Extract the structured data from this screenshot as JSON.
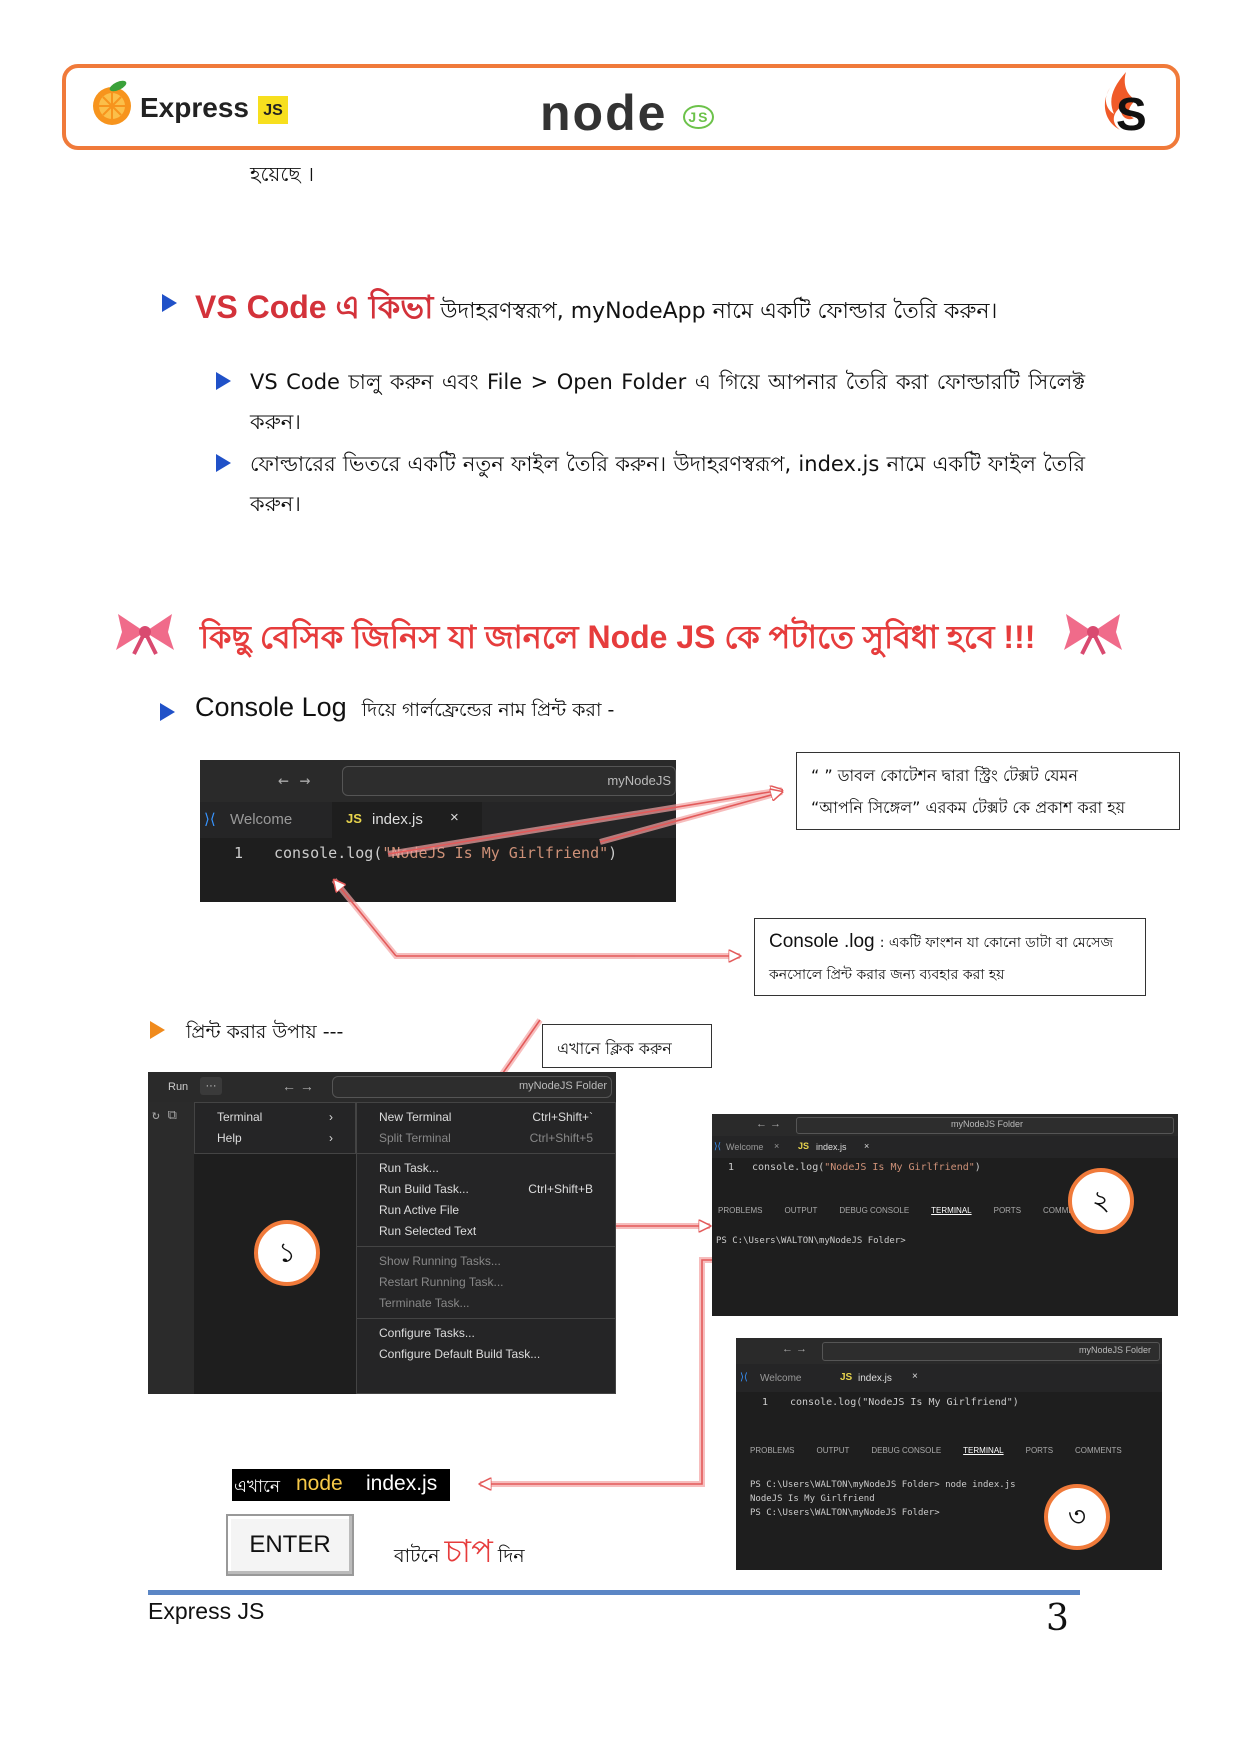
{
  "header": {
    "brand": "Express",
    "js_badge": "JS",
    "node_logo": "node",
    "node_js_mark": "JS"
  },
  "intro_tail": "হয়েছে ।",
  "section1": {
    "heading": "VS Code এ কিভা",
    "heading_rest": " উদাহরণস্বরূপ, myNodeApp নামে একটি ফোল্ডার তৈরি করুন।",
    "step1": "VS Code চালু করুন এবং File > Open Folder এ গিয়ে আপনার তৈরি করা ফোল্ডারটি সিলেক্ট করুন।",
    "step2": "ফোল্ডারের ভিতরে একটি নতুন ফাইল তৈরি করুন। উদাহরণস্বরূপ, index.js নামে একটি ফাইল তৈরি করুন।"
  },
  "section2": {
    "title": "কিছু বেসিক জিনিস যা জানলে Node JS কে পটাতে সুবিধা হবে !!!",
    "console_heading": "Console Log",
    "console_heading_rest": "দিয়ে গার্লফ্রেন্ডের নাম প্রিন্ট করা -"
  },
  "editor1": {
    "search": "myNodeJS",
    "tab_welcome": "Welcome",
    "tab_file": "index.js",
    "line_no": "1",
    "code_fn": "console.log(",
    "code_str": "\"NodeJS Is My Girlfriend\"",
    "code_end": ")"
  },
  "callout1": {
    "line1": "“ ” ডাবল কোটেশন দ্বারা স্ট্রিং টেক্সট যেমন",
    "line2": "“আপনি সিঙ্গেল” এরকম টেক্সট কে প্রকাশ করা হয়"
  },
  "callout2": {
    "term": "Console .log",
    "line1": ": একটি ফাংশন যা কোনো ডাটা বা মেসেজ",
    "line2": "কনসোলে প্রিন্ট করার জন্য ব্যবহার করা হয়"
  },
  "print_ways": "প্রিন্ট করার উপায় ---",
  "click_here": "এখানে ক্লিক করুন",
  "menu_panel": {
    "run": "Run",
    "dots": "···",
    "search": "myNodeJS Folder",
    "left_items": [
      {
        "label": "Terminal",
        "arrow": "›"
      },
      {
        "label": "Help",
        "arrow": "›"
      }
    ],
    "items": [
      {
        "label": "New Terminal",
        "shortcut": "Ctrl+Shift+`",
        "disabled": false
      },
      {
        "label": "Split Terminal",
        "shortcut": "Ctrl+Shift+5",
        "disabled": true
      },
      {
        "label": "Run Task...",
        "shortcut": "",
        "disabled": false
      },
      {
        "label": "Run Build Task...",
        "shortcut": "Ctrl+Shift+B",
        "disabled": false
      },
      {
        "label": "Run Active File",
        "shortcut": "",
        "disabled": false
      },
      {
        "label": "Run Selected Text",
        "shortcut": "",
        "disabled": false
      },
      {
        "label": "Show Running Tasks...",
        "shortcut": "",
        "disabled": true
      },
      {
        "label": "Restart Running Task...",
        "shortcut": "",
        "disabled": true
      },
      {
        "label": "Terminate Task...",
        "shortcut": "",
        "disabled": true
      },
      {
        "label": "Configure Tasks...",
        "shortcut": "",
        "disabled": false
      },
      {
        "label": "Configure Default Build Task...",
        "shortcut": "",
        "disabled": false
      }
    ],
    "badge": "১"
  },
  "terminal2": {
    "search": "myNodeJS Folder",
    "tab_welcome": "Welcome",
    "tab_file": "index.js",
    "line_no": "1",
    "code_fn": "console.log(",
    "code_str": "\"NodeJS Is My Girlfriend\"",
    "code_end": ")",
    "tabs": [
      "PROBLEMS",
      "OUTPUT",
      "DEBUG CONSOLE",
      "TERMINAL",
      "PORTS",
      "COMMENTS"
    ],
    "prompt": "PS C:\\Users\\WALTON\\myNodeJS Folder>",
    "badge": "২"
  },
  "terminal3": {
    "search": "myNodeJS Folder",
    "tab_welcome": "Welcome",
    "tab_file": "index.js",
    "line_no": "1",
    "code": "console.log(\"NodeJS Is My Girlfriend\")",
    "tabs": [
      "PROBLEMS",
      "OUTPUT",
      "DEBUG CONSOLE",
      "TERMINAL",
      "PORTS",
      "COMMENTS"
    ],
    "line1": "PS C:\\Users\\WALTON\\myNodeJS Folder> node index.js",
    "line2": "NodeJS Is My Girlfriend",
    "line3": "PS C:\\Users\\WALTON\\myNodeJS Folder>",
    "badge": "৩"
  },
  "command_box": {
    "prefix": "এখানে",
    "cmd_node": "node",
    "cmd_file": "index.js"
  },
  "enter_key": "ENTER",
  "press_text": {
    "before": "বাটনে",
    "highlight": "চাপ",
    "after": "দিন"
  },
  "footer": {
    "left": "Express JS",
    "page": "3"
  },
  "colors": {
    "accent_orange": "#f07a3a",
    "heading_red": "#d3323a",
    "bullet_blue": "#2051c8",
    "footer_blue": "#5b86c5",
    "node_green": "#6cc24a"
  }
}
